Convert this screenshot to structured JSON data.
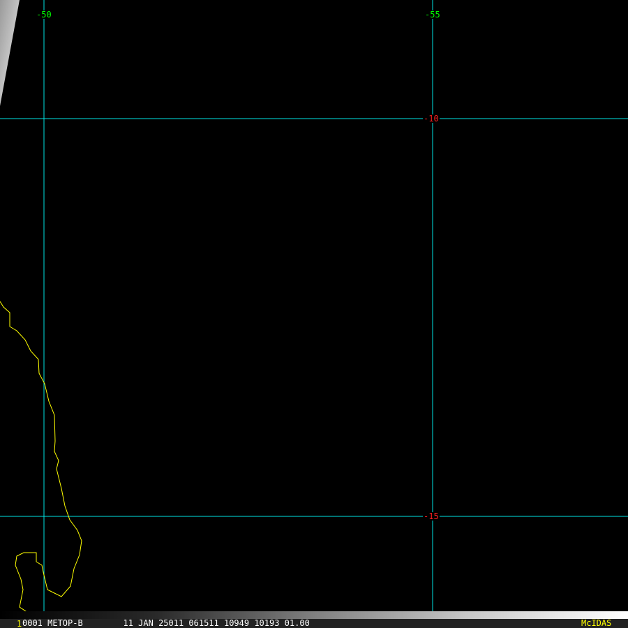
{
  "map": {
    "longitude_labels": [
      "-50",
      "-55"
    ],
    "latitude_labels": [
      "-10",
      "-15"
    ],
    "colors": {
      "grid": "#00e5e5",
      "coastline": "#ffff00",
      "lon_label": "#00ff00",
      "lat_label": "#ff2020"
    }
  },
  "footer": {
    "frame_number": "1",
    "info": "0001 METOP-B        11 JAN 25011 061511 10949 10193 01.00",
    "logo": "McIDAS"
  }
}
